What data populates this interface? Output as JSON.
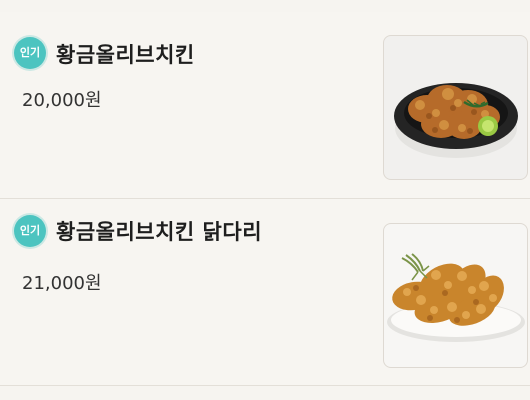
{
  "menu": {
    "items": [
      {
        "badge": "인기",
        "name": "황금올리브치킨",
        "price": "20,000원",
        "image_icon": "fried-chicken-plate-icon"
      },
      {
        "badge": "인기",
        "name": "황금올리브치킨 닭다리",
        "price": "21,000원",
        "image_icon": "chicken-drumsticks-plate-icon"
      }
    ]
  },
  "colors": {
    "background": "#f6f4f0",
    "badge": "#4cc4c0",
    "text": "#1e1e1e",
    "divider": "#e3dfd8"
  }
}
